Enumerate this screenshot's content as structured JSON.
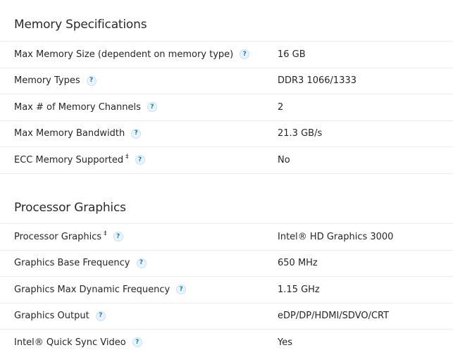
{
  "memory": {
    "title": "Memory Specifications",
    "rows": [
      {
        "label": "Max Memory Size (dependent on memory type)",
        "sup": "",
        "value": "16 GB"
      },
      {
        "label": "Memory Types",
        "sup": "",
        "value": "DDR3 1066/1333"
      },
      {
        "label": "Max # of Memory Channels",
        "sup": "",
        "value": "2"
      },
      {
        "label": "Max Memory Bandwidth",
        "sup": "",
        "value": "21.3 GB/s"
      },
      {
        "label": "ECC Memory Supported",
        "sup": "‡",
        "value": "No"
      }
    ]
  },
  "graphics": {
    "title": "Processor Graphics",
    "rows": [
      {
        "label": "Processor Graphics",
        "sup": "‡",
        "value": "Intel® HD Graphics 3000"
      },
      {
        "label": "Graphics Base Frequency",
        "sup": "",
        "value": "650 MHz"
      },
      {
        "label": "Graphics Max Dynamic Frequency",
        "sup": "",
        "value": "1.15 GHz"
      },
      {
        "label": "Graphics Output",
        "sup": "",
        "value": "eDP/DP/HDMI/SDVO/CRT"
      },
      {
        "label": "Intel® Quick Sync Video",
        "sup": "",
        "value": "Yes"
      }
    ]
  },
  "help_icon": {
    "glyph": "?",
    "icon": "question-mark-icon",
    "color": "#0f7dc2"
  }
}
